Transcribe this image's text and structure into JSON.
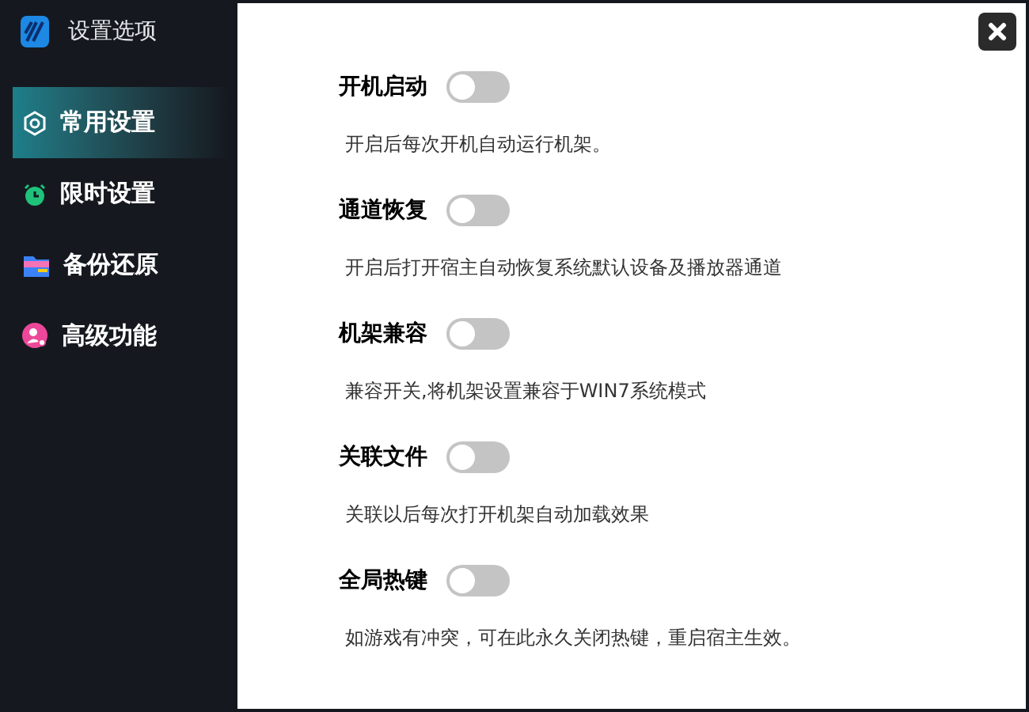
{
  "sidebar": {
    "title": "设置选项",
    "items": [
      {
        "label": "常用设置",
        "selected": true
      },
      {
        "label": "限时设置",
        "selected": false
      },
      {
        "label": "备份还原",
        "selected": false
      },
      {
        "label": "高级功能",
        "selected": false
      }
    ]
  },
  "settings": [
    {
      "label": "开机启动",
      "on": false,
      "description": "开启后每次开机自动运行机架。"
    },
    {
      "label": "通道恢复",
      "on": false,
      "description": "开启后打开宿主自动恢复系统默认设备及播放器通道"
    },
    {
      "label": "机架兼容",
      "on": false,
      "description": "兼容开关,将机架设置兼容于WIN7系统模式"
    },
    {
      "label": "关联文件",
      "on": false,
      "description": "关联以后每次打开机架自动加载效果"
    },
    {
      "label": "全局热键",
      "on": false,
      "description": "如游戏有冲突，可在此永久关闭热键，重启宿主生效。"
    }
  ]
}
